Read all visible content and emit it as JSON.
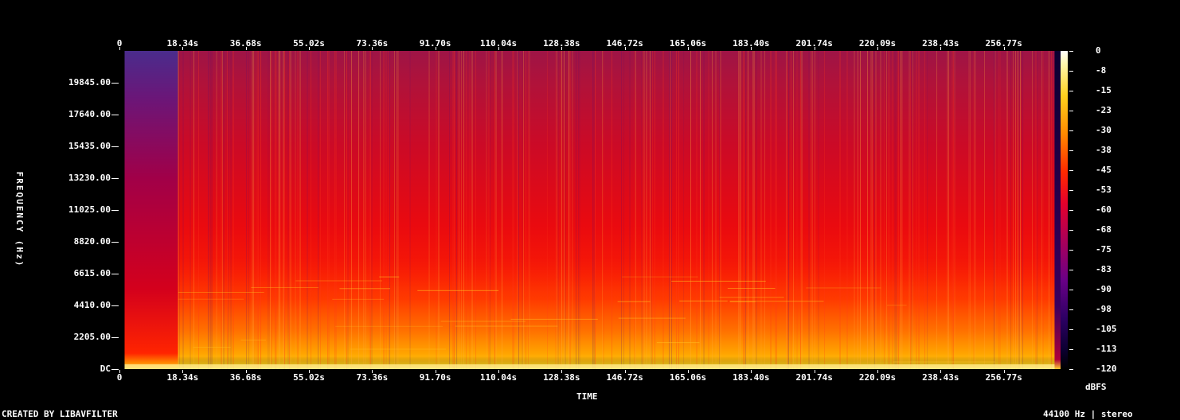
{
  "chart_data": {
    "type": "heatmap",
    "title": "",
    "xlabel": "TIME",
    "ylabel": "FREQUENCY (Hz)",
    "time_ticks": [
      "0",
      "18.34s",
      "36.68s",
      "55.02s",
      "73.36s",
      "91.70s",
      "110.04s",
      "128.38s",
      "146.72s",
      "165.06s",
      "183.40s",
      "201.74s",
      "220.09s",
      "238.43s",
      "256.77s"
    ],
    "freq_ticks": [
      "DC",
      "2205.00",
      "4410.00",
      "6615.00",
      "8820.00",
      "11025.00",
      "13230.00",
      "15435.00",
      "17640.00",
      "19845.00"
    ],
    "colorbar_ticks": [
      "0",
      "-8",
      "-15",
      "-23",
      "-30",
      "-38",
      "-45",
      "-53",
      "-60",
      "-68",
      "-75",
      "-83",
      "-90",
      "-98",
      "-105",
      "-113",
      "-120"
    ],
    "colorbar_label": "dBFS",
    "xlim": [
      0,
      275.1
    ],
    "ylim": [
      0,
      22050
    ],
    "zlim": [
      -120,
      0
    ],
    "colorscale": [
      "#000000",
      "#0b0030",
      "#2d0064",
      "#6a0087",
      "#a8005a",
      "#e4002c",
      "#ff2a00",
      "#ff8a00",
      "#ffd21e",
      "#fff7b0",
      "#ffffff"
    ],
    "description_segments": [
      {
        "start": 0,
        "end": 1.5,
        "level": "silence"
      },
      {
        "start": 1.5,
        "end": 17,
        "level": "quiet"
      },
      {
        "start": 17,
        "end": 271.5,
        "level": "loud"
      },
      {
        "start": 271.5,
        "end": 275.1,
        "level": "silence"
      }
    ]
  },
  "footer": {
    "left": "CREATED BY LIBAVFILTER",
    "right": "44100 Hz | stereo"
  }
}
